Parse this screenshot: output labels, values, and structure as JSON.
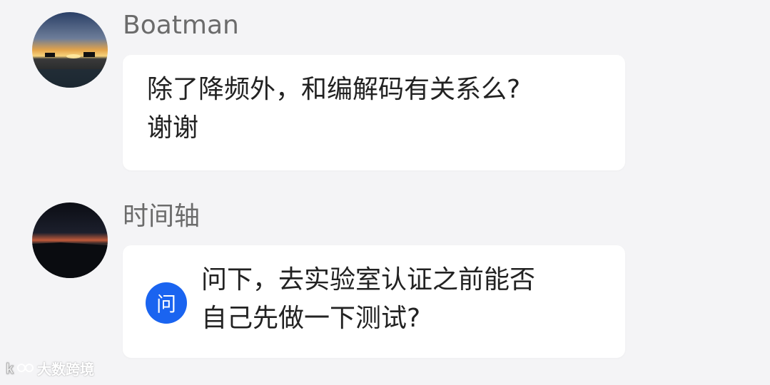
{
  "messages": [
    {
      "username": "Boatman",
      "line1": "除了降频外，和编解码有关系么?",
      "line2": "谢谢"
    },
    {
      "username": "时间轴",
      "badge": "问",
      "line1": "问下，去实验室认证之前能否",
      "line2": "自己先做一下测试?"
    }
  ],
  "watermark": {
    "text": "大数跨境",
    "icon": "logo-icon"
  }
}
